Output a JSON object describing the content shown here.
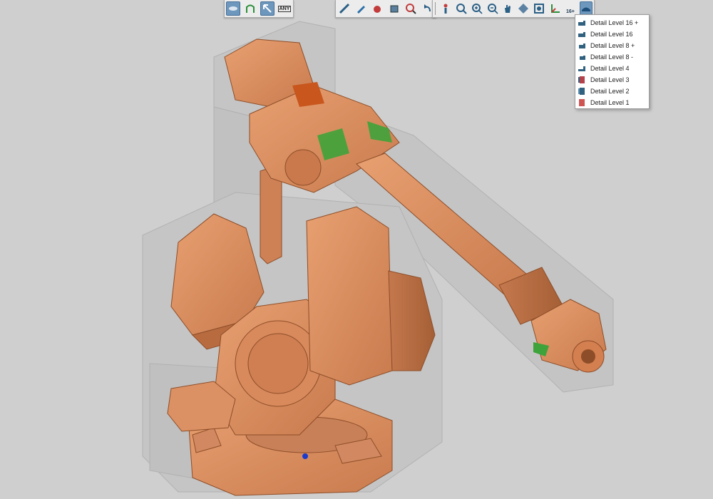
{
  "toolbar": {
    "group1": [
      {
        "name": "display-mode-icon",
        "active": true
      },
      {
        "name": "walk-mode-icon",
        "active": false
      },
      {
        "name": "select-arrow-icon",
        "active": true
      },
      {
        "name": "any-select-icon",
        "label": "ANY",
        "active": false
      }
    ],
    "group2": [
      {
        "name": "measure-tool-icon"
      },
      {
        "name": "pencil-markup-icon"
      },
      {
        "name": "explode-icon"
      },
      {
        "name": "section-cube-icon"
      },
      {
        "name": "zoom-target-icon"
      },
      {
        "name": "undo-arrow-icon"
      }
    ],
    "group3": [
      {
        "name": "pointer-figure-icon"
      },
      {
        "name": "zoom-search-icon"
      },
      {
        "name": "zoom-in-icon"
      },
      {
        "name": "zoom-out-icon"
      },
      {
        "name": "pan-hand-icon"
      },
      {
        "name": "rotate-icon"
      },
      {
        "name": "fit-view-icon"
      },
      {
        "name": "axis-orientation-icon"
      },
      {
        "name": "detail-level-icon",
        "label": "16+"
      },
      {
        "name": "detail-level-menu-icon",
        "active": true
      }
    ]
  },
  "dropdown": {
    "items": [
      {
        "label": "Detail Level 16 +",
        "icon": "detail-16plus-icon",
        "color": "#30617f"
      },
      {
        "label": "Detail Level 16",
        "icon": "detail-16-icon",
        "color": "#30617f"
      },
      {
        "label": "Detail Level 8 +",
        "icon": "detail-8plus-icon",
        "color": "#30617f"
      },
      {
        "label": "Detail Level 8 -",
        "icon": "detail-8minus-icon",
        "color": "#30617f"
      },
      {
        "label": "Detail Level 4",
        "icon": "detail-4-icon",
        "color": "#30617f"
      },
      {
        "label": "Detail Level 3",
        "icon": "detail-3-icon",
        "color": "#b4424a"
      },
      {
        "label": "Detail Level 2",
        "icon": "detail-2-icon",
        "color": "#30617f"
      },
      {
        "label": "Detail Level 1",
        "icon": "detail-1-icon",
        "color": "#cf5555"
      }
    ]
  },
  "colors": {
    "background": "#cfcfcf",
    "robot_orange": "#d98a5c",
    "robot_shade": "#b96b40",
    "bounding_box": "#a7a7a7",
    "logo_green": "#3ea33a"
  }
}
